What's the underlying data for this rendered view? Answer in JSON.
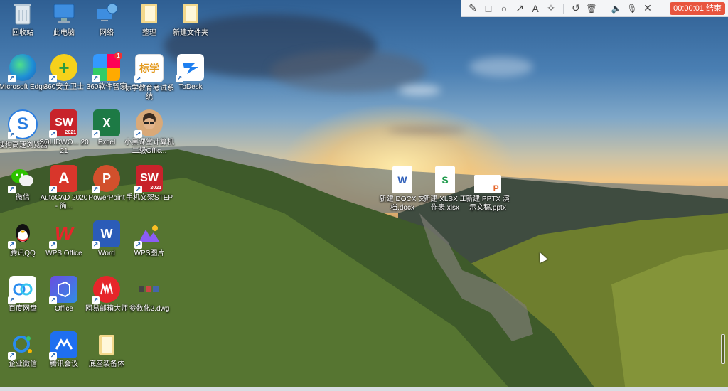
{
  "toolbar": {
    "tools": [
      {
        "name": "pen-icon",
        "glyph": "✎"
      },
      {
        "name": "rectangle-icon",
        "glyph": "□"
      },
      {
        "name": "circle-icon",
        "glyph": "○"
      },
      {
        "name": "arrow-icon",
        "glyph": "↗"
      },
      {
        "name": "text-icon",
        "glyph": "A"
      },
      {
        "name": "magic-wand-icon",
        "glyph": "✧"
      },
      {
        "name": "undo-icon",
        "glyph": "↺"
      },
      {
        "name": "trash-icon",
        "glyph": "🗑"
      },
      {
        "name": "speaker-icon",
        "glyph": "🔈"
      },
      {
        "name": "microphone-icon",
        "glyph": "🎙"
      },
      {
        "name": "close-icon",
        "glyph": "✕"
      }
    ],
    "record_label": "00:00:01 结束"
  },
  "desktop_icons": {
    "recycle_bin": "回收站",
    "this_pc": "此电脑",
    "network": "网络",
    "organize": "整理",
    "new_folder": "新建文件夹",
    "edge": "Microsoft Edge",
    "sec360": "360安全卫士",
    "soft360": "360软件管家",
    "biaoxue": "标学教育考试系统",
    "todesk": "ToDesk",
    "sogou": "搜狗高速浏览器",
    "solidworks": "SOLIDWO... 2021",
    "excel": "Excel",
    "xiaohong": "小黑课堂计算机二级Offic...",
    "wechat": "微信",
    "autocad": "AutoCAD 2020 - 简...",
    "powerpoint": "PowerPoint",
    "sw_step": "手机文架STEP",
    "qq": "腾讯QQ",
    "wps": "WPS Office",
    "word": "Word",
    "wps_pic": "WPS图片",
    "baidu": "百度网盘",
    "office": "Office",
    "netease": "网易邮箱大师",
    "dwg": "参数化2.dwg",
    "wework": "企业微信",
    "tencent_meeting": "腾讯会议",
    "backup": "底座装备体",
    "new_docx": "新建 DOCX 文档.docx",
    "new_xlsx": "新建 XLSX 工作表.xlsx",
    "new_pptx": "新建 PPTX 演示文稿.pptx"
  },
  "badges": {
    "sw_year": "2021",
    "soft360_dot": "1"
  },
  "colors": {
    "record_button": "#e8553e",
    "toolbar_bg": "#f4f5f7"
  }
}
